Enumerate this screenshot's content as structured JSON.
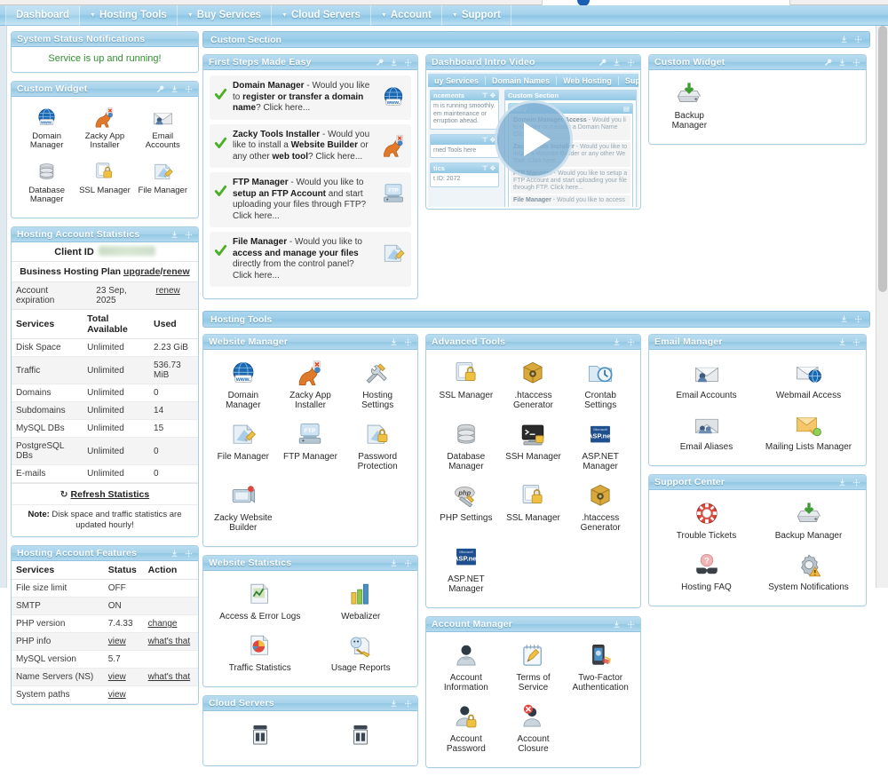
{
  "nav": {
    "items": [
      {
        "label": "Dashboard",
        "caret": false,
        "active": true
      },
      {
        "label": "Hosting Tools",
        "caret": true,
        "active": false
      },
      {
        "label": "Buy Services",
        "caret": true,
        "active": false
      },
      {
        "label": "Cloud Servers",
        "caret": true,
        "active": false
      },
      {
        "label": "Account",
        "caret": true,
        "active": false
      },
      {
        "label": "Support",
        "caret": true,
        "active": false
      }
    ]
  },
  "sidebar": {
    "system_status": {
      "title": "System Status Notifications",
      "message": "Service is up and running!",
      "message_color": "#2f8f2f"
    },
    "custom_widget": {
      "title": "Custom Widget",
      "icons": [
        {
          "label": "Domain Manager",
          "icon": "globe-www-icon"
        },
        {
          "label": "Zacky App Installer",
          "icon": "kangaroo-icon"
        },
        {
          "label": "Email Accounts",
          "icon": "envelope-user-icon"
        },
        {
          "label": "Database Manager",
          "icon": "database-icon"
        },
        {
          "label": "SSL Manager",
          "icon": "ssl-lock-icon"
        },
        {
          "label": "File Manager",
          "icon": "file-manager-icon"
        }
      ]
    },
    "statistics": {
      "title": "Hosting Account Statistics",
      "client_id_label": "Client ID",
      "client_id_value": "",
      "plan_label": "Business Hosting Plan",
      "plan_action_upgrade": "upgrade",
      "plan_action_sep": "/",
      "plan_action_renew": "renew",
      "expiration_label": "Account expiration",
      "expiration_value": "23 Sep, 2025",
      "expiration_action": "renew",
      "headers": [
        "Services",
        "Total Available",
        "Used"
      ],
      "rows": [
        [
          "Disk Space",
          "Unlimited",
          "2.23 GiB"
        ],
        [
          "Traffic",
          "Unlimited",
          "536.73 MiB"
        ],
        [
          "Domains",
          "Unlimited",
          "0"
        ],
        [
          "Subdomains",
          "Unlimited",
          "14"
        ],
        [
          "MySQL DBs",
          "Unlimited",
          "15"
        ],
        [
          "PostgreSQL DBs",
          "Unlimited",
          "0"
        ],
        [
          "E-mails",
          "Unlimited",
          "0"
        ]
      ],
      "refresh_label": "Refresh Statistics",
      "note_prefix": "Note:",
      "note_text": "Disk space and traffic statistics are updated hourly!"
    },
    "features": {
      "title": "Hosting Account Features",
      "headers": [
        "Services",
        "Status",
        "Action"
      ],
      "rows": [
        {
          "service": "File size limit",
          "status": "OFF",
          "status_link": false,
          "action": "",
          "action_link": false
        },
        {
          "service": "SMTP",
          "status": "ON",
          "status_link": false,
          "action": "",
          "action_link": false
        },
        {
          "service": "PHP version",
          "status": "7.4.33",
          "status_link": false,
          "action": "change",
          "action_link": true
        },
        {
          "service": "PHP info",
          "status": "view",
          "status_link": true,
          "action": "what's that",
          "action_link": true
        },
        {
          "service": "MySQL version",
          "status": "5.7",
          "status_link": false,
          "action": "",
          "action_link": false
        },
        {
          "service": "Name Servers (NS)",
          "status": "view",
          "status_link": true,
          "action": "what's that",
          "action_link": true
        },
        {
          "service": "System paths",
          "status": "view",
          "status_link": true,
          "action": "",
          "action_link": false
        }
      ]
    }
  },
  "sections": {
    "custom_section": {
      "title": "Custom Section"
    },
    "hosting_tools": {
      "title": "Hosting Tools"
    }
  },
  "first_steps": {
    "title": "First Steps Made Easy",
    "steps": [
      {
        "name": "Domain Manager",
        "body_1": " - Would you like to ",
        "bold_1": "register or transfer a domain name",
        "body_2": "? Click here...",
        "icon": "globe-www-icon"
      },
      {
        "name": "Zacky Tools Installer",
        "body_1": " - Would you like to install a ",
        "bold_1": "Website Builder",
        "body_2": " or any other ",
        "bold_2": "web tool",
        "body_3": "? Click here...",
        "icon": "kangaroo-icon"
      },
      {
        "name": "FTP Manager",
        "body_1": " - Would you like to ",
        "bold_1": "setup an FTP Account",
        "body_2": " and start uploading your files through FTP? Click here...",
        "icon": "ftp-icon"
      },
      {
        "name": "File Manager",
        "body_1": " - Would you like to ",
        "bold_1": "access and manage your files",
        "body_2": " directly from the control panel? Click here...",
        "icon": "file-manager-icon"
      }
    ]
  },
  "intro_video": {
    "title": "Dashboard Intro Video",
    "play_label": "play",
    "thumbnail": {
      "nav": [
        "uy Services",
        "Domain Names",
        "Web Hosting",
        "Sup"
      ],
      "left_boxes": [
        {
          "title": "ncements",
          "body": "m is running smoothly. em maintenance or erruption ahead."
        },
        {
          "title": "",
          "body": "rned Tools here"
        },
        {
          "title": "tics",
          "body": "t ID: 2072"
        }
      ],
      "right_box_title": "Custom Section",
      "right_sub_title": "Easy",
      "right_steps": [
        {
          "bold": "Domain Manager Access",
          "text": " - Would you li to register or transfer a Domain Name Click he..."
        },
        {
          "bold": "Zacky Tools Installer",
          "text": " - Would you like to install a Website Builder or any other We Tool. Click here..."
        },
        {
          "bold": "FTP Manager",
          "text": " - Would you like to setup a FTP Account and start uploading your file through FTP. Click here..."
        },
        {
          "bold": "File Manager",
          "text": " - Would you like to access"
        }
      ]
    }
  },
  "custom_widget_right": {
    "title": "Custom Widget",
    "icons": [
      {
        "label": "Backup Manager",
        "icon": "backup-drive-icon"
      }
    ]
  },
  "website_manager": {
    "title": "Website Manager",
    "icons": [
      {
        "label": "Domain Manager",
        "icon": "globe-www-icon"
      },
      {
        "label": "Zacky App Installer",
        "icon": "kangaroo-icon"
      },
      {
        "label": "Hosting Settings",
        "icon": "tools-icon"
      },
      {
        "label": "File Manager",
        "icon": "file-manager-icon"
      },
      {
        "label": "FTP Manager",
        "icon": "ftp-icon"
      },
      {
        "label": "Password Protection",
        "icon": "password-protect-icon"
      },
      {
        "label": "Zacky Website Builder",
        "icon": "website-builder-icon"
      }
    ]
  },
  "website_statistics": {
    "title": "Website Statistics",
    "icons": [
      {
        "label": "Access & Error Logs",
        "icon": "chart-doc-icon"
      },
      {
        "label": "Webalizer",
        "icon": "bar-chart-icon"
      },
      {
        "label": "Traffic Statistics",
        "icon": "pie-doc-icon"
      },
      {
        "label": "Usage Reports",
        "icon": "usage-report-icon"
      }
    ]
  },
  "cloud_servers": {
    "title": "Cloud Servers",
    "icons": [
      {
        "label": "",
        "icon": "server-rack-icon"
      },
      {
        "label": "",
        "icon": "server-rack-icon"
      }
    ]
  },
  "advanced_tools": {
    "title": "Advanced Tools",
    "icons": [
      {
        "label": "SSL Manager",
        "icon": "ssl-lock-icon"
      },
      {
        "label": ".htaccess Generator",
        "icon": "safe-box-icon"
      },
      {
        "label": "Crontab Settings",
        "icon": "clock-folder-icon"
      },
      {
        "label": "Database Manager",
        "icon": "database-icon"
      },
      {
        "label": "SSH Manager",
        "icon": "terminal-icon"
      },
      {
        "label": "ASP.NET Manager",
        "icon": "aspnet-icon"
      },
      {
        "label": "PHP Settings",
        "icon": "php-icon"
      },
      {
        "label": "SSL Manager",
        "icon": "ssl-lock-icon"
      },
      {
        "label": ".htaccess Generator",
        "icon": "safe-box-icon"
      },
      {
        "label": "ASP.NET Manager",
        "icon": "aspnet-icon"
      }
    ]
  },
  "account_manager": {
    "title": "Account Manager",
    "icons": [
      {
        "label": "Account Information",
        "icon": "user-icon"
      },
      {
        "label": "Terms of Service",
        "icon": "notepad-pencil-icon"
      },
      {
        "label": "Two-Factor Authentication",
        "icon": "phone-2fa-icon"
      },
      {
        "label": "Account Password",
        "icon": "user-lock-icon"
      },
      {
        "label": "Account Closure",
        "icon": "user-delete-icon"
      }
    ]
  },
  "email_manager": {
    "title": "Email Manager",
    "icons": [
      {
        "label": "Email Accounts",
        "icon": "envelope-user-icon"
      },
      {
        "label": "Webmail Access",
        "icon": "envelope-globe-icon"
      },
      {
        "label": "Email Aliases",
        "icon": "envelope-users-icon"
      },
      {
        "label": "Mailing Lists Manager",
        "icon": "mailing-list-icon"
      }
    ]
  },
  "support_center": {
    "title": "Support Center",
    "icons": [
      {
        "label": "Trouble Tickets",
        "icon": "lifebuoy-icon"
      },
      {
        "label": "Backup Manager",
        "icon": "backup-drive-icon"
      },
      {
        "label": "Hosting FAQ",
        "icon": "faq-glasses-icon"
      },
      {
        "label": "System Notifications",
        "icon": "gear-warning-icon"
      }
    ]
  },
  "colors": {
    "accent": "#8dc7e6",
    "header_text": "#ffffff",
    "status_ok": "#2f8f2f",
    "panel_border": "#a8cfe4"
  }
}
